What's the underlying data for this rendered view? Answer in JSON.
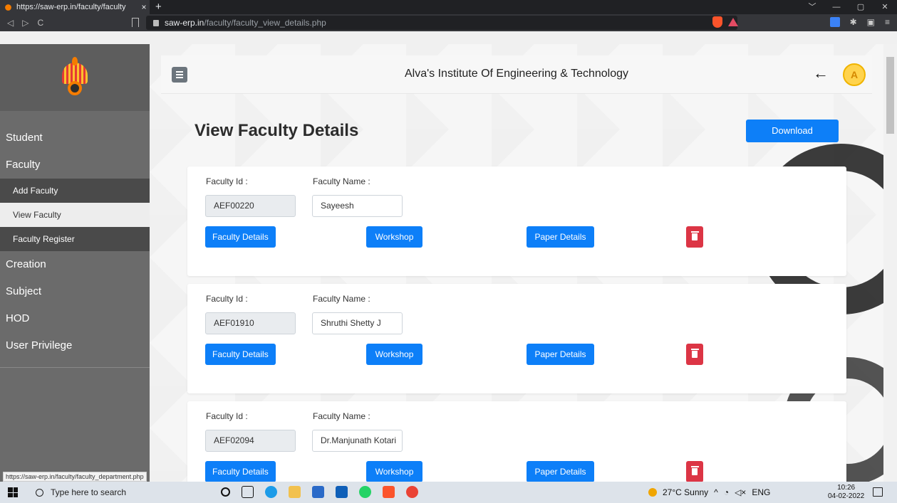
{
  "browser": {
    "tab_title": "https://saw-erp.in/faculty/faculty",
    "tab_close": "×",
    "new_tab": "+",
    "url_host": "saw-erp.in",
    "url_path": "/faculty/faculty_view_details.php",
    "status_url": "https://saw-erp.in/faculty/faculty_department.php"
  },
  "header": {
    "title": "Alva's Institute Of Engineering & Technology",
    "back": "←",
    "avatar": "A"
  },
  "sidebar": {
    "student": "Student",
    "faculty": "Faculty",
    "add_faculty": "Add Faculty",
    "view_faculty": "View Faculty",
    "faculty_register": "Faculty Register",
    "creation": "Creation",
    "subject": "Subject",
    "hod": "HOD",
    "user_privilege": "User Privilege"
  },
  "page": {
    "title": "View Faculty Details",
    "download": "Download",
    "id_label": "Faculty Id :",
    "name_label": "Faculty Name :",
    "btn_details": "Faculty Details",
    "btn_workshop": "Workshop",
    "btn_paper": "Paper Details"
  },
  "faculty": [
    {
      "id": "AEF00220",
      "name": "Sayeesh"
    },
    {
      "id": "AEF01910",
      "name": "Shruthi Shetty J"
    },
    {
      "id": "AEF02094",
      "name": "Dr.Manjunath Kotari"
    }
  ],
  "taskbar": {
    "search_placeholder": "Type here to search",
    "weather": "27°C  Sunny",
    "lang": "ENG",
    "time": "10:26",
    "date": "04-02-2022"
  },
  "colors": {
    "primary": "#0d7ff8",
    "danger": "#dc3545",
    "sidebar": "#6b6b6b"
  }
}
